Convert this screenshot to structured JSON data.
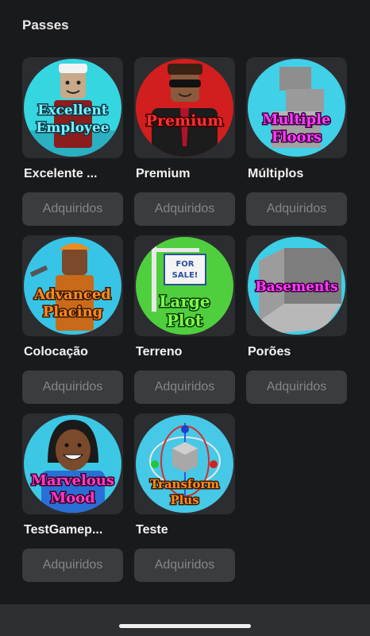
{
  "section": {
    "title": "Passes"
  },
  "passes": [
    {
      "name": "Excelente ...",
      "badge": [
        "Excellent",
        "Employee"
      ],
      "status": "Adquiridos",
      "bg": "#36d6e0",
      "badge_color": "#7bf0ff"
    },
    {
      "name": "Premium",
      "badge": [
        "Premium"
      ],
      "status": "Adquiridos",
      "bg": "#d21e1e",
      "badge_color": "#ff3030"
    },
    {
      "name": "Múltiplos",
      "badge": [
        "Multiple",
        "Floors"
      ],
      "status": "Adquiridos",
      "bg": "#40d0e8",
      "badge_color": "#ff3cff"
    },
    {
      "name": "Colocação",
      "badge": [
        "Advanced",
        "Placing"
      ],
      "status": "Adquiridos",
      "bg": "#38c4e6",
      "badge_color": "#ff8a1c"
    },
    {
      "name": "Terreno",
      "badge": [
        "Large",
        "Plot"
      ],
      "status": "Adquiridos",
      "bg": "#4fcf3e",
      "badge_color": "#7cff4a"
    },
    {
      "name": "Porões",
      "badge": [
        "Basements"
      ],
      "status": "Adquiridos",
      "bg": "#3ccfe6",
      "badge_color": "#ff3cff"
    },
    {
      "name": "TestGamep...",
      "badge": [
        "Marvelous",
        "Mood"
      ],
      "status": "Adquiridos",
      "bg": "#3cc8e4",
      "badge_color": "#ff3cc8"
    },
    {
      "name": "Teste",
      "badge": [
        "Transform",
        "Plus"
      ],
      "status": "Adquiridos",
      "bg": "#46c8e6",
      "badge_color": "#ff8a1c"
    }
  ]
}
